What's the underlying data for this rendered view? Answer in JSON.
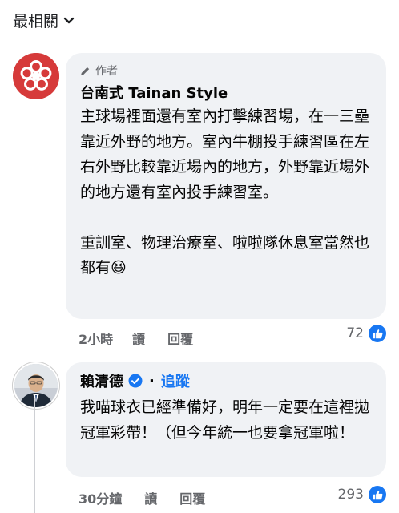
{
  "sort": {
    "label": "最相關"
  },
  "comments": [
    {
      "author_tag": "作者",
      "name": "台南式 Tainan Style",
      "text": "主球場裡面還有室內打擊練習場，在一三壘靠近外野的地方。室內牛棚投手練習區在左右外野比較靠近場內的地方，外野靠近場外的地方還有室內投手練習室。\n\n重訓室、物理治療室、啦啦隊休息室當然也都有😆",
      "time": "2小時",
      "read": "讀",
      "reply": "回覆",
      "likes": "72"
    },
    {
      "name": "賴清德",
      "follow": "追蹤",
      "separator": "·",
      "text": "我喵球衣已經準備好，明年一定要在這裡拋冠軍彩帶！（但今年統一也要拿冠軍啦！",
      "time": "30分鐘",
      "read": "讀",
      "reply": "回覆",
      "likes": "293"
    }
  ],
  "colors": {
    "link": "#1877f2",
    "bubble": "#f0f2f5",
    "meta": "#65676b"
  },
  "icons": [
    "chevron-down-icon",
    "pen-icon",
    "verified-badge-icon",
    "like-icon"
  ]
}
